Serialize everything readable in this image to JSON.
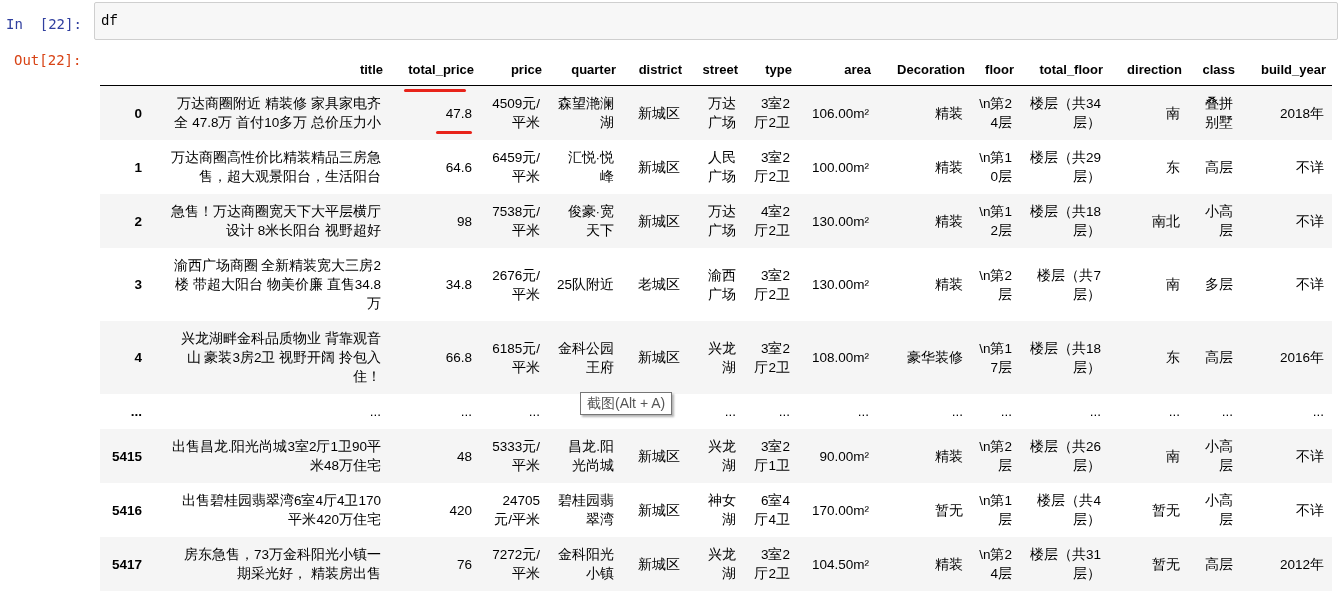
{
  "input_cell": {
    "prompt": "In  [22]:",
    "code": "df"
  },
  "output_cell": {
    "prompt": "Out[22]:"
  },
  "table": {
    "columns": [
      {
        "name": "title",
        "marked": false
      },
      {
        "name": "total_price",
        "marked": true
      },
      {
        "name": "price",
        "marked": false
      },
      {
        "name": "quarter",
        "marked": false
      },
      {
        "name": "district",
        "marked": false
      },
      {
        "name": "street",
        "marked": false
      },
      {
        "name": "type",
        "marked": false
      },
      {
        "name": "area",
        "marked": false
      },
      {
        "name": "Decoration",
        "marked": false
      },
      {
        "name": "floor",
        "marked": false
      },
      {
        "name": "total_floor",
        "marked": false
      },
      {
        "name": "direction",
        "marked": false
      },
      {
        "name": "class",
        "marked": false
      },
      {
        "name": "build_year",
        "marked": false
      }
    ],
    "rows": [
      {
        "index": "0",
        "marked": true,
        "cells": [
          "万达商圈附近 精装修 家具家电齐全 47.8万 首付10多万 总价压力小",
          "47.8",
          "4509元/平米",
          "森望滟澜湖",
          "新城区",
          "万达广场",
          "3室2厅2卫",
          "106.00m²",
          "精装",
          "\\n第24层",
          "楼层（共34层）",
          "南",
          "叠拼别墅",
          "2018年"
        ]
      },
      {
        "index": "1",
        "marked": false,
        "cells": [
          "万达商圈高性价比精装精品三房急售，超大观景阳台，生活阳台",
          "64.6",
          "6459元/平米",
          "汇悦·悦峰",
          "新城区",
          "人民广场",
          "3室2厅2卫",
          "100.00m²",
          "精装",
          "\\n第10层",
          "楼层（共29层）",
          "东",
          "高层",
          "不详"
        ]
      },
      {
        "index": "2",
        "marked": false,
        "cells": [
          "急售！万达商圈宽天下大平层横厅设计 8米长阳台 视野超好",
          "98",
          "7538元/平米",
          "俊豪·宽天下",
          "新城区",
          "万达广场",
          "4室2厅2卫",
          "130.00m²",
          "精装",
          "\\n第12层",
          "楼层（共18层）",
          "南北",
          "小高层",
          "不详"
        ]
      },
      {
        "index": "3",
        "marked": false,
        "cells": [
          "渝西广场商圈 全新精装宽大三房2楼 带超大阳台 物美价廉 直售34.8万",
          "34.8",
          "2676元/平米",
          "25队附近",
          "老城区",
          "渝西广场",
          "3室2厅2卫",
          "130.00m²",
          "精装",
          "\\n第2层",
          "楼层（共7层）",
          "南",
          "多层",
          "不详"
        ]
      },
      {
        "index": "4",
        "marked": false,
        "cells": [
          "兴龙湖畔金科品质物业 背靠观音山 豪装3房2卫 视野开阔 拎包入住！",
          "66.8",
          "6185元/平米",
          "金科公园王府",
          "新城区",
          "兴龙湖",
          "3室2厅2卫",
          "108.00m²",
          "豪华装修",
          "\\n第17层",
          "楼层（共18层）",
          "东",
          "高层",
          "2016年"
        ]
      },
      {
        "index": "...",
        "marked": false,
        "cells": [
          "...",
          "...",
          "...",
          null,
          null,
          "...",
          "...",
          "...",
          "...",
          "...",
          "...",
          "...",
          "...",
          "..."
        ]
      },
      {
        "index": "5415",
        "marked": false,
        "cells": [
          "出售昌龙.阳光尚城3室2厅1卫90平米48万住宅",
          "48",
          "5333元/平米",
          "昌龙.阳光尚城",
          "新城区",
          "兴龙湖",
          "3室2厅1卫",
          "90.00m²",
          "精装",
          "\\n第2层",
          "楼层（共26层）",
          "南",
          "小高层",
          "不详"
        ]
      },
      {
        "index": "5416",
        "marked": false,
        "cells": [
          "出售碧桂园翡翠湾6室4厅4卫170平米420万住宅",
          "420",
          "24705元/平米",
          "碧桂园翡翠湾",
          "新城区",
          "神女湖",
          "6室4厅4卫",
          "170.00m²",
          "暂无",
          "\\n第1层",
          "楼层（共4层）",
          "暂无",
          "小高层",
          "不详"
        ]
      },
      {
        "index": "5417",
        "marked": false,
        "cells": [
          "房东急售，73万金科阳光小镇一期采光好， 精装房出售",
          "76",
          "7272元/平米",
          "金科阳光小镇",
          "新城区",
          "兴龙湖",
          "3室2厅2卫",
          "104.50m²",
          "精装",
          "\\n第24层",
          "楼层（共31层）",
          "暂无",
          "高层",
          "2012年"
        ]
      }
    ]
  },
  "tooltip": {
    "text": "截图(Alt + A)"
  }
}
